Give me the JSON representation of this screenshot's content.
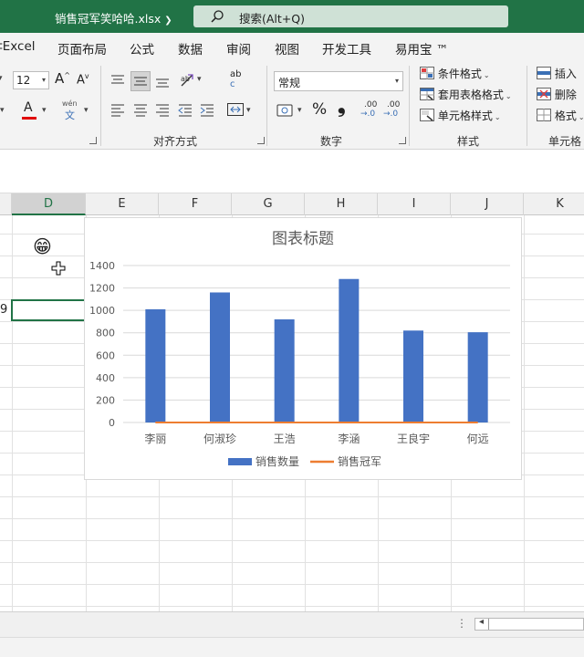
{
  "titlebar": {
    "doc_title": "销售冠军笑哈哈.xlsx",
    "search_placeholder": "搜索(Alt+Q)"
  },
  "menu": {
    "tabs": [
      "‡Excel",
      "页面布局",
      "公式",
      "数据",
      "审阅",
      "视图",
      "开发工具",
      "易用宝 ™"
    ]
  },
  "ribbon": {
    "font_size": "12",
    "number_format": "常规",
    "percent_symbol": "%",
    "comma_symbol": "❟",
    "groups": {
      "alignment": "对齐方式",
      "number": "数字",
      "styles": "样式",
      "cells": "单元格"
    },
    "styles": {
      "conditional": "条件格式",
      "table": "套用表格格式",
      "cell_styles": "单元格样式"
    },
    "cells": {
      "insert": "插入",
      "delete": "删除",
      "format": "格式"
    },
    "font_grow": "A",
    "font_shrink": "A",
    "wen_top": "wén",
    "wen_bottom": "文",
    "ab_top": "ab",
    "ab_bottom": "c",
    "dec_inc_top": ".00",
    "dec_inc_bottom": "→.0",
    "dec_dec_top": ".00",
    "dec_dec_bottom": "→.0"
  },
  "sheet": {
    "columns": [
      "D",
      "E",
      "F",
      "G",
      "H",
      "I",
      "J",
      "K"
    ],
    "selected_column": "D",
    "active_cell_value": "9",
    "emoji": "😁"
  },
  "chart_data": {
    "type": "bar",
    "title": "图表标题",
    "categories": [
      "李丽",
      "何淑珍",
      "王浩",
      "李涵",
      "王良宇",
      "何远"
    ],
    "series": [
      {
        "name": "销售数量",
        "values": [
          1010,
          1160,
          920,
          1280,
          820,
          805
        ],
        "color": "#4472c4"
      },
      {
        "name": "销售冠军",
        "values": [
          0,
          0,
          0,
          0,
          0,
          0
        ],
        "color": "#ed7d31",
        "line": true
      }
    ],
    "ylim": [
      0,
      1400
    ],
    "yticks": [
      0,
      200,
      400,
      600,
      800,
      1000,
      1200,
      1400
    ],
    "grid": true,
    "legend": "bottom"
  },
  "colors": {
    "excel_green": "#217346",
    "bar_blue": "#4472c4",
    "line_orange": "#ed7d31"
  }
}
